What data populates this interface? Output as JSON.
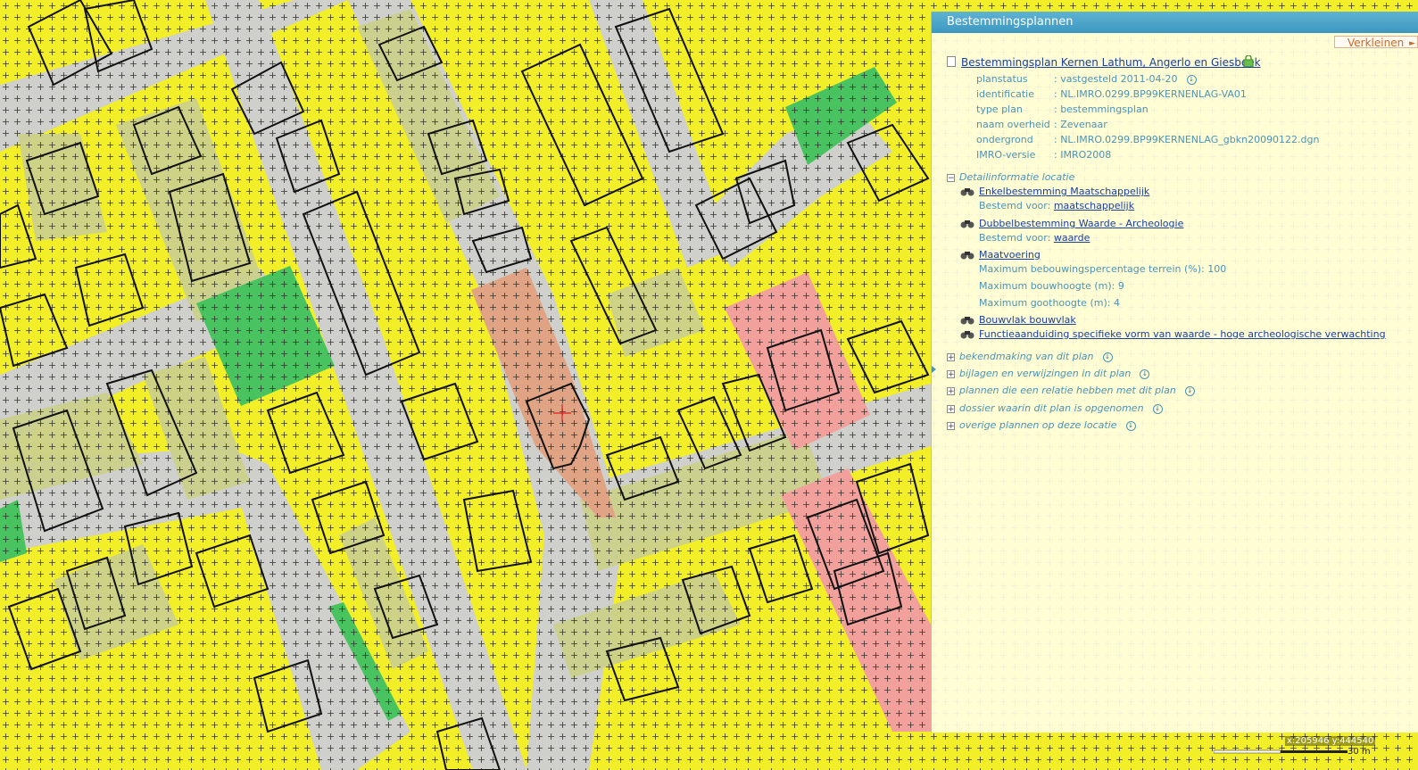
{
  "panel": {
    "title": "Bestemmingsplannen",
    "verkleinen": "Verkleinen",
    "plan_title": "Bestemmingsplan Kernen Lathum, Angerlo en Giesbeek",
    "meta": [
      {
        "key": "planstatus",
        "value": ": vastgesteld 2011-04-20"
      },
      {
        "key": "identificatie",
        "value": ": NL.IMRO.0299.BP99KERNENLAG-VA01"
      },
      {
        "key": "type plan",
        "value": ": bestemmingsplan"
      },
      {
        "key": "naam overheid",
        "value": ": Zevenaar"
      },
      {
        "key": "ondergrond",
        "value": ": NL.IMRO.0299.BP99KERNENLAG_gbkn20090122.dgn"
      },
      {
        "key": "IMRO-versie",
        "value": ": IMRO2008"
      }
    ],
    "detail_header": "Detailinformatie locatie",
    "details": {
      "enkel": {
        "link": "Enkelbestemming Maatschappelijk",
        "sub_label": "Bestemd voor: ",
        "sub_link": "maatschappelijk"
      },
      "dubbel": {
        "link": "Dubbelbestemming Waarde - Archeologie",
        "sub_label": "Bestemd voor: ",
        "sub_link": "waarde"
      },
      "maatvoering": {
        "link": "Maatvoering",
        "lines": [
          "Maximum bebouwingspercentage terrein (%): 100",
          "Maximum bouwhoogte (m): 9",
          "Maximum goothoogte (m): 4"
        ]
      },
      "bouwvlak": {
        "link": "Bouwvlak bouwvlak"
      },
      "functie": {
        "link": "Functieaanduiding specifieke vorm van waarde - hoge archeologische verwachting"
      }
    },
    "sections": [
      "bekendmaking van dit plan",
      "bijlagen en verwijzingen in dit plan",
      "plannen die een relatie hebben met dit plan",
      "dossier waarin dit plan is opgenomen",
      "overige plannen op deze locatie"
    ]
  },
  "map": {
    "coords": "x:205946 y:444540",
    "scale": "30 m",
    "colors": {
      "wonen": "#f2ee27",
      "verkeer": "#cfd0cc",
      "tuin": "#cbd08b",
      "groen": "#48c35f",
      "maatschappelijk": "#f2a09c",
      "maatschappelijk_selected": "#e0a383"
    }
  }
}
